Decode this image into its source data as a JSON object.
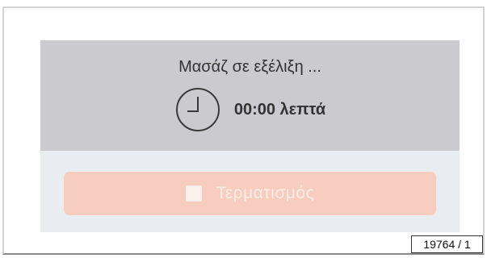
{
  "status": {
    "title": "Μασάζ σε εξέλιξη ...",
    "timer": "00:00 λεπτά",
    "clock_icon": "clock-icon"
  },
  "actions": {
    "stop_label": "Τερματισμός",
    "stop_icon": "stop-square-icon"
  },
  "reference": {
    "label": "19764 / 1"
  },
  "colors": {
    "status_panel_bg": "#cbcacf",
    "action_panel_bg": "#e9ecf1",
    "stop_button_bg": "#f6cdbf",
    "text": "#333333"
  }
}
